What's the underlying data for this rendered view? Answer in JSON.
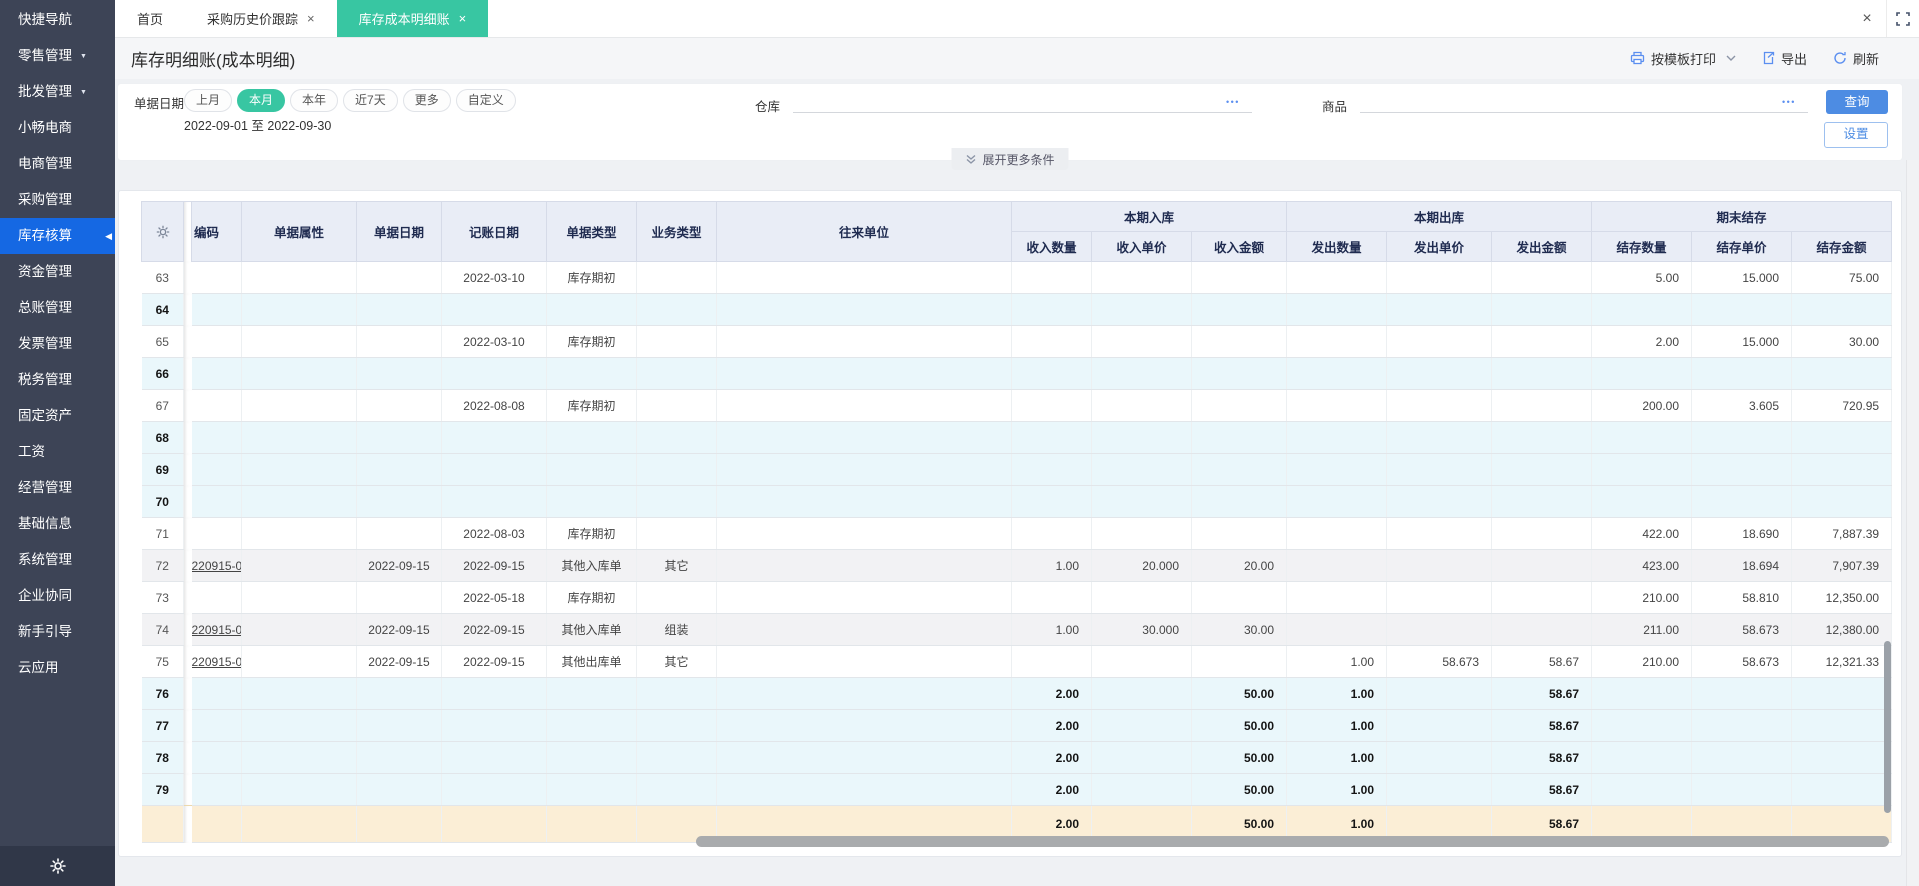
{
  "sidebar": {
    "items": [
      {
        "label": "快捷导航"
      },
      {
        "label": "零售管理",
        "arrow": true
      },
      {
        "label": "批发管理",
        "arrow": true
      },
      {
        "label": "小畅电商"
      },
      {
        "label": "电商管理"
      },
      {
        "label": "采购管理"
      },
      {
        "label": "库存核算",
        "active": true
      },
      {
        "label": "资金管理"
      },
      {
        "label": "总账管理"
      },
      {
        "label": "发票管理"
      },
      {
        "label": "税务管理"
      },
      {
        "label": "固定资产"
      },
      {
        "label": "工资"
      },
      {
        "label": "经营管理"
      },
      {
        "label": "基础信息"
      },
      {
        "label": "系统管理"
      },
      {
        "label": "企业协同"
      },
      {
        "label": "新手引导"
      },
      {
        "label": "云应用"
      }
    ]
  },
  "tabs": [
    {
      "label": "首页",
      "closable": false,
      "active": false
    },
    {
      "label": "采购历史价跟踪",
      "closable": true,
      "active": false
    },
    {
      "label": "库存成本明细账",
      "closable": true,
      "active": true
    }
  ],
  "window": {
    "close_label": "×"
  },
  "toolbar": {
    "title": "库存明细账(成本明细)",
    "print_label": "按模板打印",
    "export_label": "导出",
    "refresh_label": "刷新"
  },
  "filters": {
    "date_label": "单据日期",
    "date_options": [
      "上月",
      "本月",
      "本年",
      "近7天",
      "更多",
      "自定义"
    ],
    "date_active": "本月",
    "date_range": "2022-09-01 至 2022-09-30",
    "warehouse_label": "仓库",
    "product_label": "商品",
    "expand_label": "展开更多条件",
    "search_label": "查询",
    "settings_label": "设置",
    "ellipsis": "•••"
  },
  "table": {
    "group_headers": [
      "本期入库",
      "本期出库",
      "期末结存"
    ],
    "columns": [
      "编码",
      "单据属性",
      "单据日期",
      "记账日期",
      "单据类型",
      "业务类型",
      "往来单位",
      "收入数量",
      "收入单价",
      "收入金额",
      "发出数量",
      "发出单价",
      "发出金额",
      "结存数量",
      "结存单价",
      "结存金额"
    ],
    "rows": [
      {
        "n": "63",
        "rdate": "2022-03-10",
        "dtype": "库存期初",
        "bq": "5.00",
        "bp": "15.000",
        "ba": "75.00",
        "bg": "white"
      },
      {
        "n": "64",
        "bg": "cyan",
        "bold": true
      },
      {
        "n": "65",
        "rdate": "2022-03-10",
        "dtype": "库存期初",
        "bq": "2.00",
        "bp": "15.000",
        "ba": "30.00",
        "bg": "white"
      },
      {
        "n": "66",
        "bg": "cyan",
        "bold": true
      },
      {
        "n": "67",
        "rdate": "2022-08-08",
        "dtype": "库存期初",
        "bq": "200.00",
        "bp": "3.605",
        "ba": "720.95",
        "bg": "white"
      },
      {
        "n": "68",
        "bg": "cyan",
        "bold": true
      },
      {
        "n": "69",
        "bg": "cyan",
        "bold": true
      },
      {
        "n": "70",
        "bg": "cyan",
        "bold": true
      },
      {
        "n": "71",
        "rdate": "2022-08-03",
        "dtype": "库存期初",
        "bq": "422.00",
        "bp": "18.690",
        "ba": "7,887.39",
        "bg": "white"
      },
      {
        "n": "72",
        "code": "220915-0",
        "ddate": "2022-09-15",
        "rdate": "2022-09-15",
        "dtype": "其他入库单",
        "btype": "其它",
        "iq": "1.00",
        "ip": "20.000",
        "ia": "20.00",
        "bq": "423.00",
        "bp": "18.694",
        "ba": "7,907.39",
        "bg": "gray"
      },
      {
        "n": "73",
        "rdate": "2022-05-18",
        "dtype": "库存期初",
        "bq": "210.00",
        "bp": "58.810",
        "ba": "12,350.00",
        "bg": "white"
      },
      {
        "n": "74",
        "code": "220915-0",
        "ddate": "2022-09-15",
        "rdate": "2022-09-15",
        "dtype": "其他入库单",
        "btype": "组装",
        "iq": "1.00",
        "ip": "30.000",
        "ia": "30.00",
        "bq": "211.00",
        "bp": "58.673",
        "ba": "12,380.00",
        "bg": "gray"
      },
      {
        "n": "75",
        "code": "220915-0",
        "ddate": "2022-09-15",
        "rdate": "2022-09-15",
        "dtype": "其他出库单",
        "btype": "其它",
        "oq": "1.00",
        "op": "58.673",
        "oa": "58.67",
        "bq": "210.00",
        "bp": "58.673",
        "ba": "12,321.33",
        "bg": "white"
      },
      {
        "n": "76",
        "iq": "2.00",
        "ia": "50.00",
        "oq": "1.00",
        "oa": "58.67",
        "bg": "cyan",
        "bold": true
      },
      {
        "n": "77",
        "iq": "2.00",
        "ia": "50.00",
        "oq": "1.00",
        "oa": "58.67",
        "bg": "cyan",
        "bold": true
      },
      {
        "n": "78",
        "iq": "2.00",
        "ia": "50.00",
        "oq": "1.00",
        "oa": "58.67",
        "bg": "cyan",
        "bold": true
      },
      {
        "n": "79",
        "iq": "2.00",
        "ia": "50.00",
        "oq": "1.00",
        "oa": "58.67",
        "bg": "cyan",
        "bold": true
      },
      {
        "n": "",
        "iq": "2.00",
        "ia": "50.00",
        "oq": "1.00",
        "oa": "58.67",
        "bg": "yellow",
        "bold": true
      }
    ]
  },
  "colors": {
    "accent_green": "#38c6a2",
    "sidebar_active_blue": "#1568e3",
    "button_blue": "#4d8ce3",
    "row_cyan": "#eaf7fb",
    "row_gray": "#f2f2f4",
    "row_yellow": "#fbeed6",
    "header_bg": "#e9edf6",
    "sidebar_bg": "#3d4456"
  }
}
